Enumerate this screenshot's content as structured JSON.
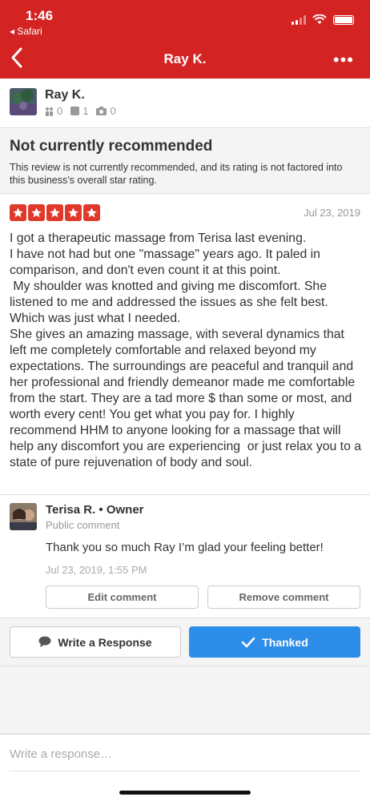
{
  "status_bar": {
    "time": "1:46",
    "back_app": "◂ Safari"
  },
  "nav": {
    "title": "Ray K.",
    "more": "•••"
  },
  "user": {
    "name": "Ray K.",
    "friends": "0",
    "reviews": "1",
    "photos": "0"
  },
  "notice": {
    "title": "Not currently recommended",
    "text": "This review is not currently recommended, and its rating is not factored into this business’s overall star rating."
  },
  "review": {
    "rating": 5,
    "date": "Jul 23, 2019",
    "text": "I got a therapeutic massage from Terisa last evening.\nI have not had but one \"massage\" years ago. It paled in comparison, and don't even count it at this point.\n My shoulder was knotted and giving me discomfort. She listened to me and addressed the issues as she felt best. Which was just what I needed.\nShe gives an amazing massage, with several dynamics that left me completely comfortable and relaxed beyond my expectations. The surroundings are peaceful and tranquil and her professional and friendly demeanor made me comfortable from the start. They are a tad more $ than some or most, and worth every cent! You get what you pay for. I highly recommend HHM to anyone looking for a massage that will help any discomfort you are experiencing  or just relax you to a state of pure rejuvenation of body and soul."
  },
  "owner_comment": {
    "name": "Terisa R.",
    "role": "• Owner",
    "subtitle": "Public comment",
    "text": "Thank you so much Ray I’m glad your feeling better!",
    "date": "Jul 23, 2019, 1:55 PM",
    "edit_label": "Edit comment",
    "remove_label": "Remove comment"
  },
  "actions": {
    "write_label": "Write a Response",
    "thanked_label": "Thanked"
  },
  "response": {
    "placeholder": "Write a response…"
  },
  "colors": {
    "brand_red": "#d32323",
    "star_red": "#e0392b",
    "thanked_blue": "#2d8ee9"
  }
}
